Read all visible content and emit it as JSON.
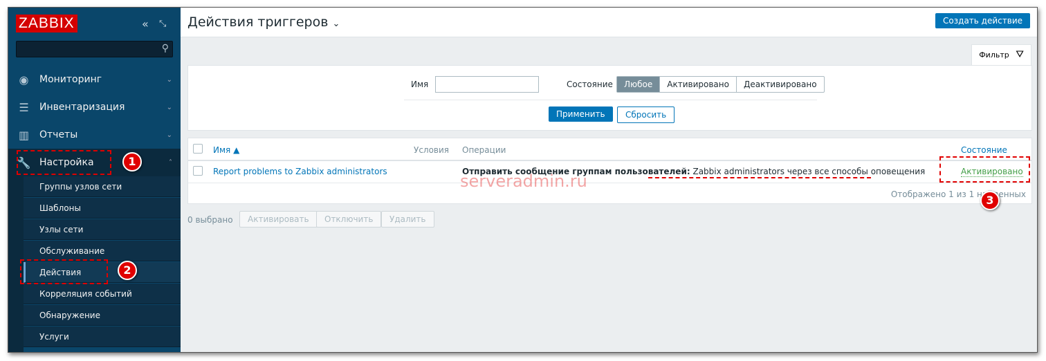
{
  "sidebar": {
    "logo": "ZABBIX",
    "collapse_icon": "«",
    "kiosk_icon": "⤡",
    "menu": [
      {
        "label": "Мониторинг",
        "icon": "eye"
      },
      {
        "label": "Инвентаризация",
        "icon": "list"
      },
      {
        "label": "Отчеты",
        "icon": "chart"
      },
      {
        "label": "Настройка",
        "icon": "wrench"
      }
    ],
    "submenu": [
      "Группы узлов сети",
      "Шаблоны",
      "Узлы сети",
      "Обслуживание",
      "Действия",
      "Корреляция событий",
      "Обнаружение",
      "Услуги"
    ]
  },
  "header": {
    "title": "Действия триггеров",
    "create": "Создать действие"
  },
  "filter": {
    "tab": "Фильтр",
    "name_label": "Имя",
    "name_value": "",
    "state_label": "Состояние",
    "states": [
      "Любое",
      "Активировано",
      "Деактивировано"
    ],
    "apply": "Применить",
    "reset": "Сбросить"
  },
  "table": {
    "headers": {
      "name": "Имя ▲",
      "conditions": "Условия",
      "operations": "Операции",
      "status": "Состояние"
    },
    "rows": [
      {
        "name": "Report problems to Zabbix administrators",
        "conditions": "",
        "op_bold": "Отправить сообщение группам пользователей:",
        "op_rest": " Zabbix administrators через все способы оповещения",
        "status": "Активировано"
      }
    ],
    "footer": "Отображено 1 из 1 найденных"
  },
  "actions": {
    "selected": "0 выбрано",
    "activate": "Активировать",
    "disable": "Отключить",
    "delete": "Удалить"
  },
  "annotations": {
    "b1": "1",
    "b2": "2",
    "b3": "3",
    "watermark": "serveradmin.ru"
  }
}
